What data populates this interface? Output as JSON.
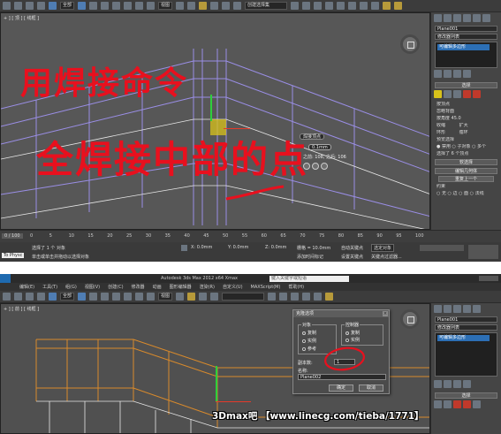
{
  "top_screen": {
    "toolbar": {
      "filter_dropdown": "全部",
      "view_dropdown": "视图",
      "selection_set_dropdown": "创建选择集"
    },
    "viewport": {
      "label": "+ ] [ 顶 ] [ 线框 ]"
    },
    "annotation": {
      "line1": "用焊接命令",
      "line2": "全焊接中部的点"
    },
    "weld_caddy": {
      "title": "焊接顶点",
      "value": "0.1mm",
      "hint": "之前: 108, 之后: 106"
    },
    "command_panel": {
      "object_name": "Plane001",
      "modifier_list": "修改器列表",
      "stack_item": "可编辑多边形",
      "rollout_selection": "选择",
      "check_by_vertex": "按顶点",
      "check_ignore_backfacing": "忽略背面",
      "check_by_angle": "按角度",
      "angle_value": "45.0",
      "btn_shrink": "收缩",
      "btn_grow": "扩大",
      "btn_ring": "环形",
      "btn_loop": "循环",
      "preview_selection": "预览选择",
      "preview_options": "● 禁用  ○ 子对象  ○ 多个",
      "selected_info": "选择了 6 个顶点",
      "rollout_soft": "软选择",
      "rollout_edit_geometry": "编辑几何体",
      "btn_repeat_last": "重复上一个",
      "constraints": "约束",
      "constraint_options": "○ 无  ○ 边  ○ 面  ○ 法线"
    },
    "timeline": {
      "frame_counter": "0 / 100",
      "ticks": [
        "0",
        "5",
        "10",
        "15",
        "20",
        "25",
        "30",
        "35",
        "40",
        "45",
        "50",
        "55",
        "60",
        "65",
        "70",
        "75",
        "80",
        "85",
        "90",
        "95",
        "100"
      ]
    },
    "status": {
      "left_label": "To Physc",
      "line1": "选择了 1 个 对象",
      "line2": "单击或单击并拖动以选择对象",
      "x_field": "X: 0.0mm",
      "y_field": "Y: 0.0mm",
      "z_field": "Z: 0.0mm",
      "grid": "栅格 = 10.0mm",
      "auto_key": "自动关键点",
      "selected_dropdown": "选定对象",
      "set_key": "设置关键点",
      "key_filters": "关键点过滤器...",
      "add_time_tag": "添加时间标记"
    }
  },
  "bottom_screen": {
    "menu": [
      "编辑(E)",
      "工具(T)",
      "组(G)",
      "视图(V)",
      "创建(C)",
      "修改器",
      "动画",
      "图形编辑器",
      "渲染(R)",
      "自定义(U)",
      "MAXScript(M)",
      "帮助(H)"
    ],
    "title": "Autodesk 3ds Max  2012 x64    Xmax",
    "search_placeholder": "键入关键字或短语",
    "toolbar": {
      "filter_dropdown": "全部",
      "view_dropdown": "视图"
    },
    "viewport": {
      "label": "+ ] [ 前 ] [ 线框 ]"
    },
    "clone_dialog": {
      "title": "克隆选项",
      "group_object": "对象",
      "opt_copy": "复制",
      "opt_instance": "实例",
      "opt_reference": "参考",
      "group_controller": "控制器",
      "ctrl_copy": "复制",
      "ctrl_instance": "实例",
      "copies_label": "副本数:",
      "copies_value": "1",
      "name_label": "名称:",
      "name_value": "Plane002",
      "ok": "确定",
      "cancel": "取消"
    },
    "command_panel": {
      "object_name": "Plane001",
      "modifier_list": "修改器列表",
      "stack_item": "可编辑多边形",
      "rollout_selection": "选择"
    }
  },
  "watermark": "3Dmax吧  【www.linecg.com/tieba/1771】",
  "colors": {
    "viewport_gray": "#575757",
    "panel_gray": "#454545",
    "annotation_red": "#e8101e",
    "selection_blue": "#2c6fb5",
    "wire_purple": "#9a8ee6",
    "wire_orange": "#d98a2b",
    "gizmo_yellow": "#d8c21a"
  }
}
